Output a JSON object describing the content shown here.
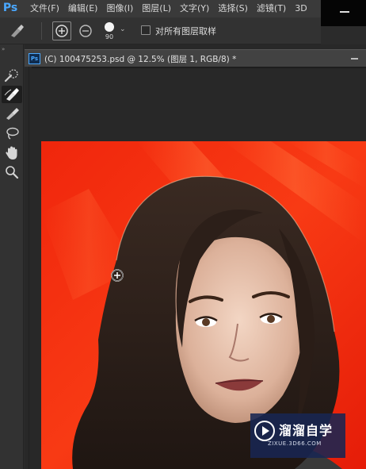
{
  "app": {
    "logo": "Ps"
  },
  "menu": [
    "文件(F)",
    "编辑(E)",
    "图像(I)",
    "图层(L)",
    "文字(Y)",
    "选择(S)",
    "滤镜(T)",
    "3D"
  ],
  "options": {
    "brush_size": "90",
    "sample_all_layers_label": "对所有图层取样",
    "sample_all_layers_checked": false
  },
  "tools": [
    {
      "icon": "quick-selection-icon"
    },
    {
      "icon": "refine-edge-brush-icon",
      "active": true
    },
    {
      "icon": "brush-icon"
    },
    {
      "icon": "lasso-icon"
    },
    {
      "icon": "hand-icon"
    },
    {
      "icon": "zoom-icon"
    }
  ],
  "document": {
    "tab_icon": "Ps",
    "tab_title": "(C) 100475253.psd @ 12.5% (图层 1, RGB/8) *"
  },
  "watermark": {
    "brand": "溜溜自学",
    "url": "ZIXUE.3D66.COM"
  },
  "colors": {
    "canvas_background": "#f42a0d",
    "ui_dark": "#2b2b2b",
    "accent": "#4aa8ff"
  }
}
